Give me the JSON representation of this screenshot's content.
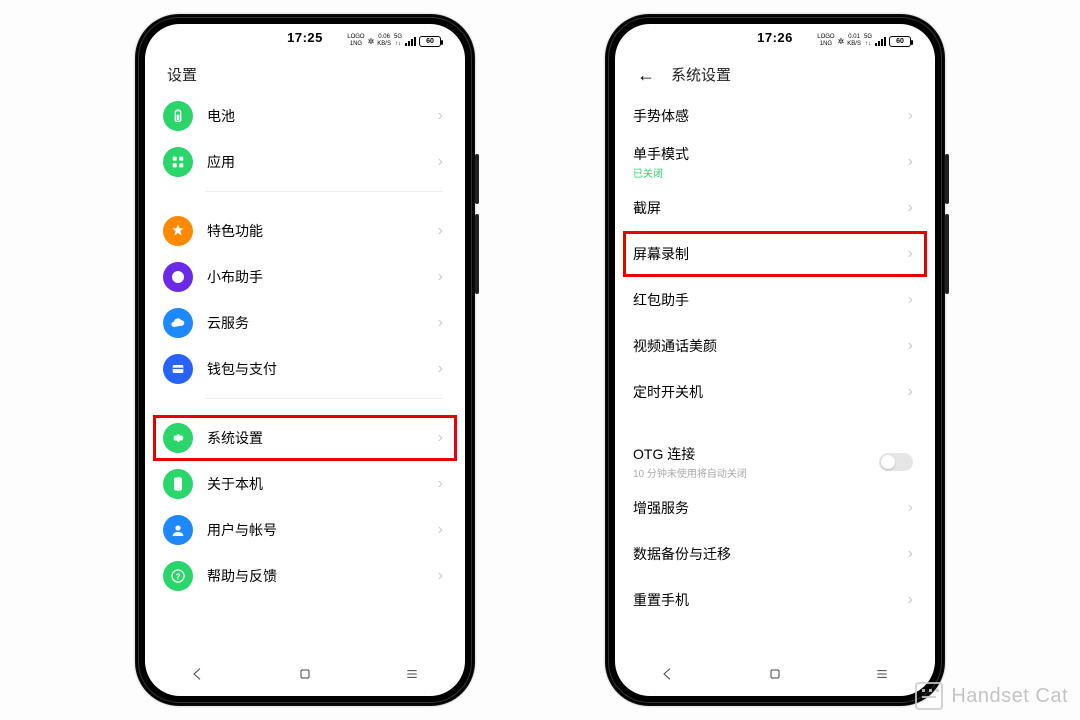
{
  "watermark": "Handset Cat",
  "phone_left": {
    "status": {
      "time": "17:25",
      "net_label": "LOGO\n1NG",
      "speed": "0.06\nKB/S",
      "bt": "᛭",
      "fiveg": "5G",
      "battery": "60"
    },
    "header": {
      "title": "设置"
    },
    "groups": [
      {
        "rows": [
          {
            "icon": "battery",
            "color": "#2ad66a",
            "label": "电池"
          },
          {
            "icon": "apps",
            "color": "#2ad66a",
            "label": "应用"
          }
        ]
      },
      {
        "rows": [
          {
            "icon": "star",
            "color": "#ff8a00",
            "label": "特色功能"
          },
          {
            "icon": "assist",
            "color": "#6a2ae8",
            "label": "小布助手"
          },
          {
            "icon": "cloud",
            "color": "#1e88ff",
            "label": "云服务"
          },
          {
            "icon": "wallet",
            "color": "#2962ff",
            "label": "钱包与支付"
          }
        ]
      },
      {
        "rows": [
          {
            "icon": "gear",
            "color": "#2ad66a",
            "label": "系统设置",
            "highlight": true
          },
          {
            "icon": "phoneinfo",
            "color": "#2ad66a",
            "label": "关于本机"
          },
          {
            "icon": "user",
            "color": "#1e88ff",
            "label": "用户与帐号"
          },
          {
            "icon": "help",
            "color": "#2ad66a",
            "label": "帮助与反馈"
          }
        ]
      }
    ]
  },
  "phone_right": {
    "status": {
      "time": "17:26",
      "net_label": "LOGO\n1NG",
      "speed": "0.01\nKB/S",
      "bt": "᛭",
      "fiveg": "5G",
      "battery": "60"
    },
    "header": {
      "title": "系统设置"
    },
    "groups": [
      {
        "rows": [
          {
            "label": "手势体感"
          },
          {
            "label": "单手模式",
            "sub": "已关闭"
          },
          {
            "label": "截屏"
          },
          {
            "label": "屏幕录制",
            "highlight": true
          },
          {
            "label": "红包助手"
          },
          {
            "label": "视频通话美颜"
          },
          {
            "label": "定时开关机"
          }
        ]
      },
      {
        "rows": [
          {
            "label": "OTG 连接",
            "sub_grey": "10 分钟未使用将自动关闭",
            "toggle": true
          },
          {
            "label": "增强服务"
          },
          {
            "label": "数据备份与迁移"
          },
          {
            "label": "重置手机"
          }
        ]
      }
    ]
  },
  "nav": {
    "back": "◁",
    "home": "▢",
    "recent": "≡"
  }
}
